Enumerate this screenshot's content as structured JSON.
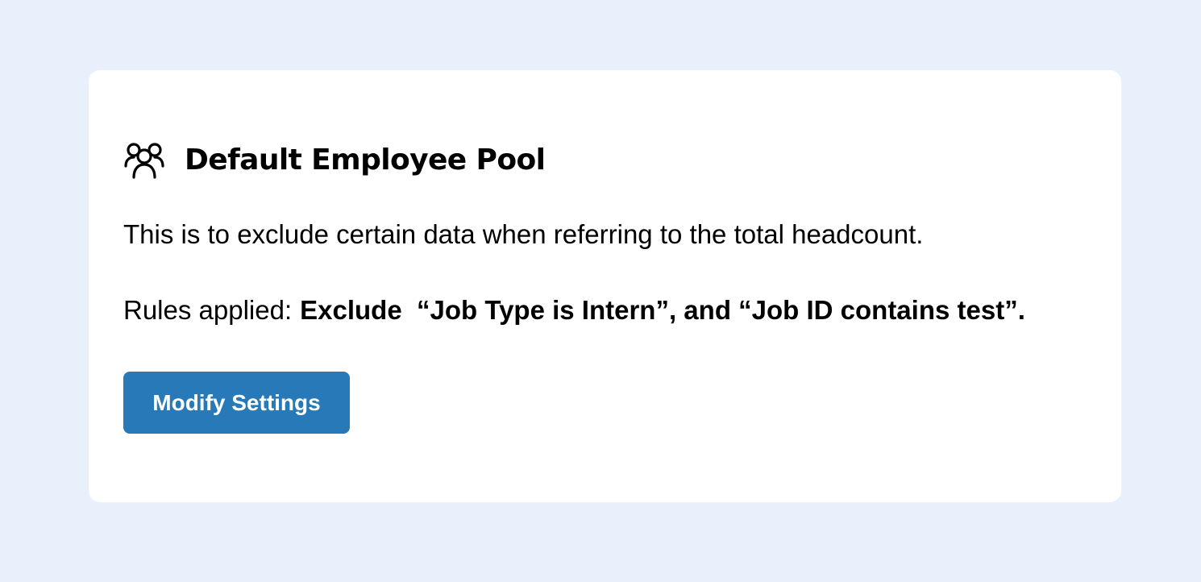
{
  "colors": {
    "page_background": "#e8f0fc",
    "card_background": "#ffffff",
    "button_background": "#2779b8",
    "button_text": "#ffffff",
    "text": "#000000"
  },
  "card": {
    "icon": "users-group-icon",
    "title": "Default Employee Pool",
    "description": "This is to exclude certain data when referring to the total headcount.",
    "rules": {
      "label": "Rules applied:",
      "value": "Exclude  “Job Type is Intern”, and “Job ID contains test”."
    },
    "modify_button_label": "Modify Settings"
  }
}
